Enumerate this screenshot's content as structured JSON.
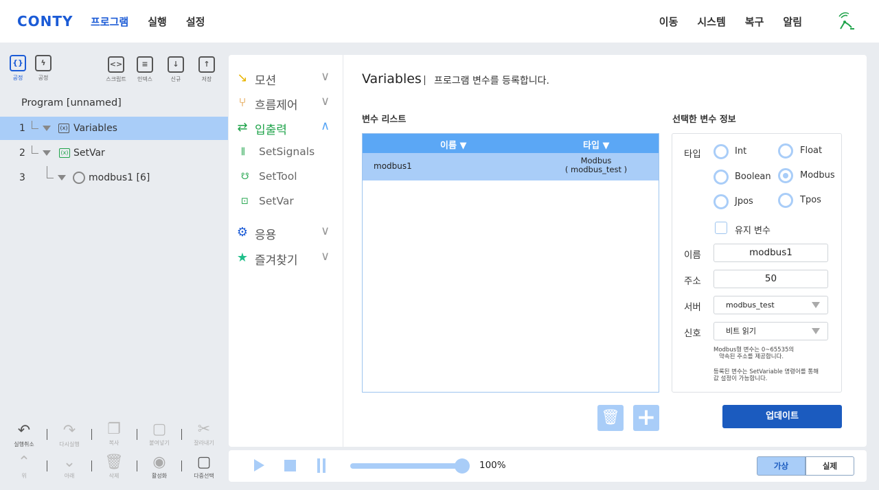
{
  "header": {
    "logo": "CONTY",
    "nav_left": [
      "프로그램",
      "실행",
      "설정"
    ],
    "nav_right": [
      "이동",
      "시스템",
      "복구",
      "알림"
    ]
  },
  "toolbar": {
    "icons": [
      {
        "label": "공정",
        "icon": "code-braces-icon"
      },
      {
        "label": "공정",
        "icon": "lightning-icon"
      },
      {
        "label": "스크립트",
        "icon": "script-icon"
      },
      {
        "label": "인덱스",
        "icon": "index-icon"
      },
      {
        "label": "신규",
        "icon": "new-icon"
      },
      {
        "label": "저장",
        "icon": "save-icon"
      }
    ]
  },
  "program": {
    "title": "Program [unnamed]",
    "tree": [
      {
        "num": "1",
        "label": "Variables"
      },
      {
        "num": "2",
        "label": "SetVar"
      },
      {
        "num": "3",
        "label": "modbus1 [6]"
      }
    ]
  },
  "bottom_tools": {
    "undo": "실행취소",
    "redo": "다시실행",
    "copy": "복사",
    "paste": "붙여넣기",
    "cut": "잘라내기",
    "up": "위",
    "down": "아래",
    "delete": "삭제",
    "activate": "활성화",
    "multi_select": "다중선택"
  },
  "commands": {
    "motion": "모션",
    "flow": "흐름제어",
    "io": "입출력",
    "set_signals": "SetSignals",
    "set_tool": "SetTool",
    "set_var": "SetVar",
    "app": "응용",
    "favorites": "즐겨찾기"
  },
  "content": {
    "title": "Variables",
    "description": "프로그램 변수를 등록합니다.",
    "list_title": "변수 리스트",
    "info_title": "선택한 변수 정보",
    "col_name": "이름 ▼",
    "col_type": "타입 ▼",
    "rows": [
      {
        "name": "modbus1",
        "type_line1": "Modbus",
        "type_line2": "( modbus_test )"
      }
    ]
  },
  "info": {
    "type_label": "타입",
    "types": [
      "Int",
      "Float",
      "Boolean",
      "Modbus",
      "Jpos",
      "Tpos"
    ],
    "selected_type": "Modbus",
    "keep_label": "유지 변수",
    "name_label": "이름",
    "name_value": "modbus1",
    "address_label": "주소",
    "address_value": "50",
    "server_label": "서버",
    "server_value": "modbus_test",
    "signal_label": "신호",
    "signal_value": "비트 읽기",
    "note1_line1": "Modbus형 변수는 0~65535의",
    "note1_line2": "약속된 주소를 제공합니다.",
    "note2_line1": "등록된 변수는 SetVariable 명령어를 통해",
    "note2_line2": "값 설정이 가능합니다."
  },
  "update_label": "업데이트",
  "run_bar": {
    "speed": "100%",
    "speed_value": 100,
    "virtual": "가상",
    "real": "실제",
    "active_mode": "가상"
  },
  "colors": {
    "brand": "#1b5bd6",
    "selection": "#a9cdf8",
    "table_header": "#5ba7f5",
    "update_button": "#1b5bbf",
    "green": "#1fa34a"
  }
}
